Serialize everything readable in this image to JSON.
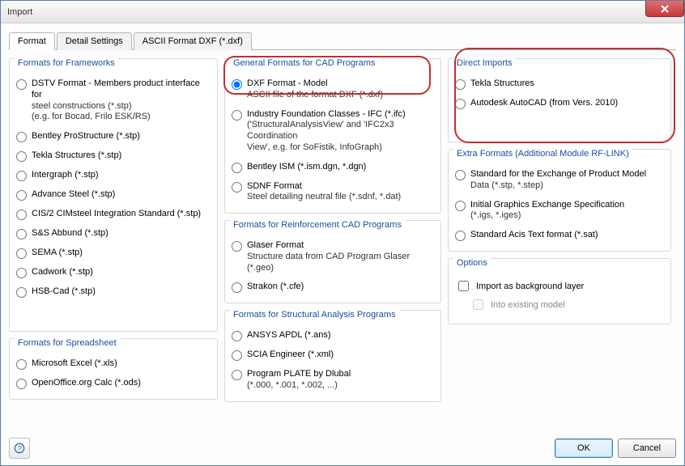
{
  "window": {
    "title": "Import"
  },
  "tabs": [
    "Format",
    "Detail Settings",
    "ASCII Format DXF (*.dxf)"
  ],
  "groups": {
    "frameworks": {
      "title": "Formats for Frameworks",
      "items": [
        {
          "line1": "DSTV Format - Members product interface for",
          "line2": "steel constructions (*.stp)",
          "line3": "(e.g. for Bocad, Frilo ESK/RS)"
        },
        {
          "line1": "Bentley ProStructure (*.stp)"
        },
        {
          "line1": "Tekla Structures (*.stp)"
        },
        {
          "line1": "Intergraph (*.stp)"
        },
        {
          "line1": "Advance Steel (*.stp)"
        },
        {
          "line1": "CIS/2 CIMsteel Integration Standard (*.stp)"
        },
        {
          "line1": "S&S Abbund (*.stp)"
        },
        {
          "line1": "SEMA (*.stp)"
        },
        {
          "line1": "Cadwork (*.stp)"
        },
        {
          "line1": "HSB-Cad (*.stp)"
        }
      ]
    },
    "spreadsheet": {
      "title": "Formats for Spreadsheet",
      "items": [
        {
          "line1": "Microsoft Excel (*.xls)"
        },
        {
          "line1": "OpenOffice.org Calc (*.ods)"
        }
      ]
    },
    "general_cad": {
      "title": "General Formats for CAD Programs",
      "items": [
        {
          "line1": "DXF Format - Model",
          "line2": "ASCII file of the format DXF (*.dxf)"
        },
        {
          "line1": "Industry Foundation Classes - IFC (*.ifc)",
          "line2": "('StructuralAnalysisView' and 'IFC2x3 Coordination",
          "line3": "View', e.g. for SoFistik, InfoGraph)"
        },
        {
          "line1": "Bentley ISM (*.ism.dgn, *.dgn)"
        },
        {
          "line1": "SDNF Format",
          "line2": "Steel detailing neutral file (*.sdnf, *.dat)"
        }
      ]
    },
    "reinf_cad": {
      "title": "Formats for Reinforcement CAD Programs",
      "items": [
        {
          "line1": "Glaser Format",
          "line2": "Structure data from CAD Program Glaser (*.geo)"
        },
        {
          "line1": "Strakon (*.cfe)"
        }
      ]
    },
    "structural": {
      "title": "Formats for Structural Analysis Programs",
      "items": [
        {
          "line1": "ANSYS APDL (*.ans)"
        },
        {
          "line1": "SCIA Engineer (*.xml)"
        },
        {
          "line1": "Program PLATE by Dlubal",
          "line2": "(*.000, *.001, *.002, ...)"
        }
      ]
    },
    "direct": {
      "title": "Direct Imports",
      "items": [
        {
          "line1": "Tekla Structures"
        },
        {
          "line1": "Autodesk AutoCAD (from Vers. 2010)"
        }
      ]
    },
    "extra": {
      "title": "Extra Formats (Additional Module RF-LINK)",
      "items": [
        {
          "line1": "Standard for the Exchange of Product Model",
          "line2": "Data (*.stp, *.step)"
        },
        {
          "line1": "Initial Graphics Exchange Specification",
          "line2": "(*.igs, *.iges)"
        },
        {
          "line1": "Standard Acis Text format (*.sat)"
        }
      ]
    },
    "options": {
      "title": "Options",
      "items": [
        "Import as background layer",
        "Into existing model"
      ]
    }
  },
  "footer": {
    "ok": "OK",
    "cancel": "Cancel"
  }
}
